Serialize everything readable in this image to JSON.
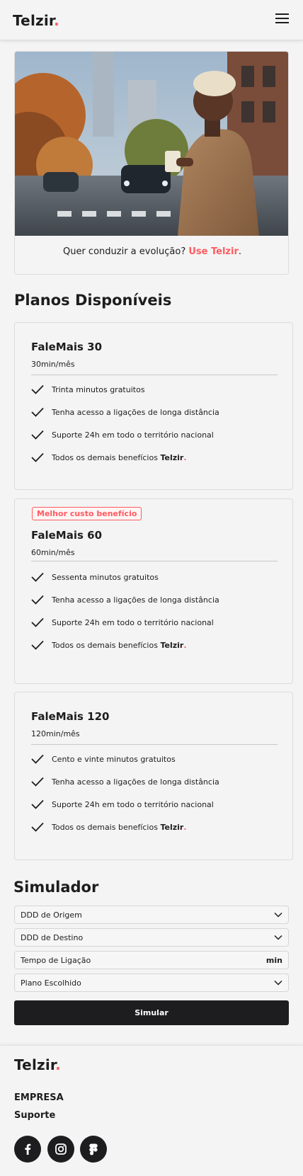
{
  "header": {
    "logo_text": "Telzir",
    "logo_dot": ".",
    "menu_icon": "hamburger-icon"
  },
  "hero": {
    "caption_text": "Quer conduzir a evolução? ",
    "caption_link": "Use Telzir",
    "caption_end": "."
  },
  "plans_section": {
    "title": "Planos Disponíveis",
    "plans": [
      {
        "name": "FaleMais 30",
        "minutes": "30min/mês",
        "badge": "",
        "features": [
          "Trinta minutos gratuitos",
          "Tenha acesso a ligações de longa distância",
          "Suporte 24h em todo o território nacional",
          "Todos os demais benefícios "
        ],
        "brand": "Telzir",
        "brand_dot": "."
      },
      {
        "name": "FaleMais 60",
        "minutes": "60min/mês",
        "badge": "Melhor custo benefício",
        "features": [
          "Sessenta minutos gratuitos",
          "Tenha acesso a ligações de longa distância",
          "Suporte 24h em todo o território nacional",
          "Todos os demais benefícios "
        ],
        "brand": "Telzir",
        "brand_dot": "."
      },
      {
        "name": "FaleMais 120",
        "minutes": "120min/mês",
        "badge": "",
        "features": [
          "Cento e vinte minutos gratuitos",
          "Tenha acesso a ligações de longa distância",
          "Suporte 24h em todo o território nacional",
          "Todos os demais benefícios "
        ],
        "brand": "Telzir",
        "brand_dot": "."
      }
    ]
  },
  "simulator": {
    "title": "Simulador",
    "origin_label": "DDD de Origem",
    "destination_label": "DDD de Destino",
    "time_label": "Tempo de Ligação",
    "time_suffix": "min",
    "plan_label": "Plano Escolhido",
    "submit_label": "Simular"
  },
  "footer": {
    "logo_text": "Telzir",
    "logo_dot": ".",
    "links": [
      "EMPRESA",
      "Suporte"
    ],
    "social_icons": [
      "facebook-icon",
      "instagram-icon",
      "figma-icon"
    ]
  },
  "colors": {
    "accent": "#ff5a5f",
    "dark": "#1d1d1f",
    "background": "#f4f4f4"
  }
}
